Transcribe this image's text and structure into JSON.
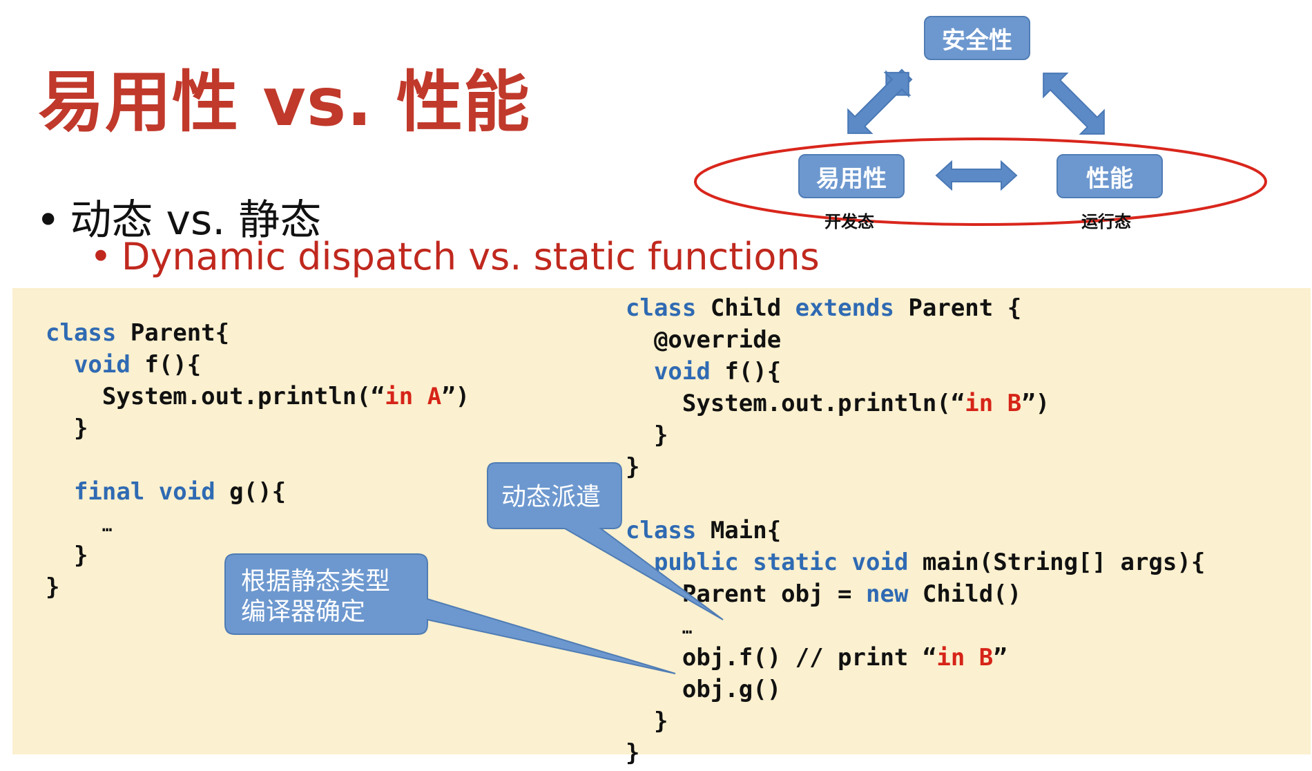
{
  "title": "易用性 vs. 性能",
  "bullets": {
    "main": {
      "marker": "•",
      "text": "动态 vs. 静态"
    },
    "sub": {
      "marker": "•",
      "text": "Dynamic dispatch vs. static functions"
    }
  },
  "diagram": {
    "top_box": "安全性",
    "left_box": "易用性",
    "right_box": "性能",
    "left_caption": "开发态",
    "right_caption": "运行态"
  },
  "colors": {
    "title": "#c0392b",
    "subbullet": "#c0281e",
    "box_fill": "#6d98cf",
    "arrow_fill": "#5b8ac6",
    "ellipse": "#d9261c",
    "code_background": "#fbf0cf",
    "keyword": "#2f6ab3",
    "string": "#d62418"
  },
  "code_left": {
    "l1_kw": "class",
    "l1_rest": " Parent{",
    "l2_kw": "void",
    "l2_rest": " f(){",
    "l3_pre": "System.out.println(“",
    "l3_str": "in A",
    "l3_post": "”)",
    "l4": "}",
    "l5_kw1": "final",
    "l5_kw2": "void",
    "l5_rest": " g(){",
    "l6": "…",
    "l7": "}",
    "l8": "}"
  },
  "code_right": {
    "l1_kw1": "class",
    "l1_mid": " Child ",
    "l1_kw2": "extends",
    "l1_rest": " Parent {",
    "l2": "@override",
    "l3_kw": "void",
    "l3_rest": " f(){",
    "l4_pre": "System.out.println(“",
    "l4_str": "in B",
    "l4_post": "”)",
    "l5": "}",
    "l6": "}",
    "l7_kw": "class",
    "l7_rest": " Main{",
    "l8_kw": "public static void",
    "l8_rest": " main(String[] args){",
    "l9_pre": "Parent obj = ",
    "l9_kw": "new",
    "l9_rest": " Child()",
    "l10": "…",
    "l11_pre": "obj.f() // print “",
    "l11_str": "in B",
    "l11_post": "”",
    "l12": "obj.g()",
    "l13": "}",
    "l14": "}"
  },
  "callouts": {
    "dynamic_dispatch": "动态派遣",
    "static_line1": "根据静态类型",
    "static_line2": "编译器确定"
  }
}
